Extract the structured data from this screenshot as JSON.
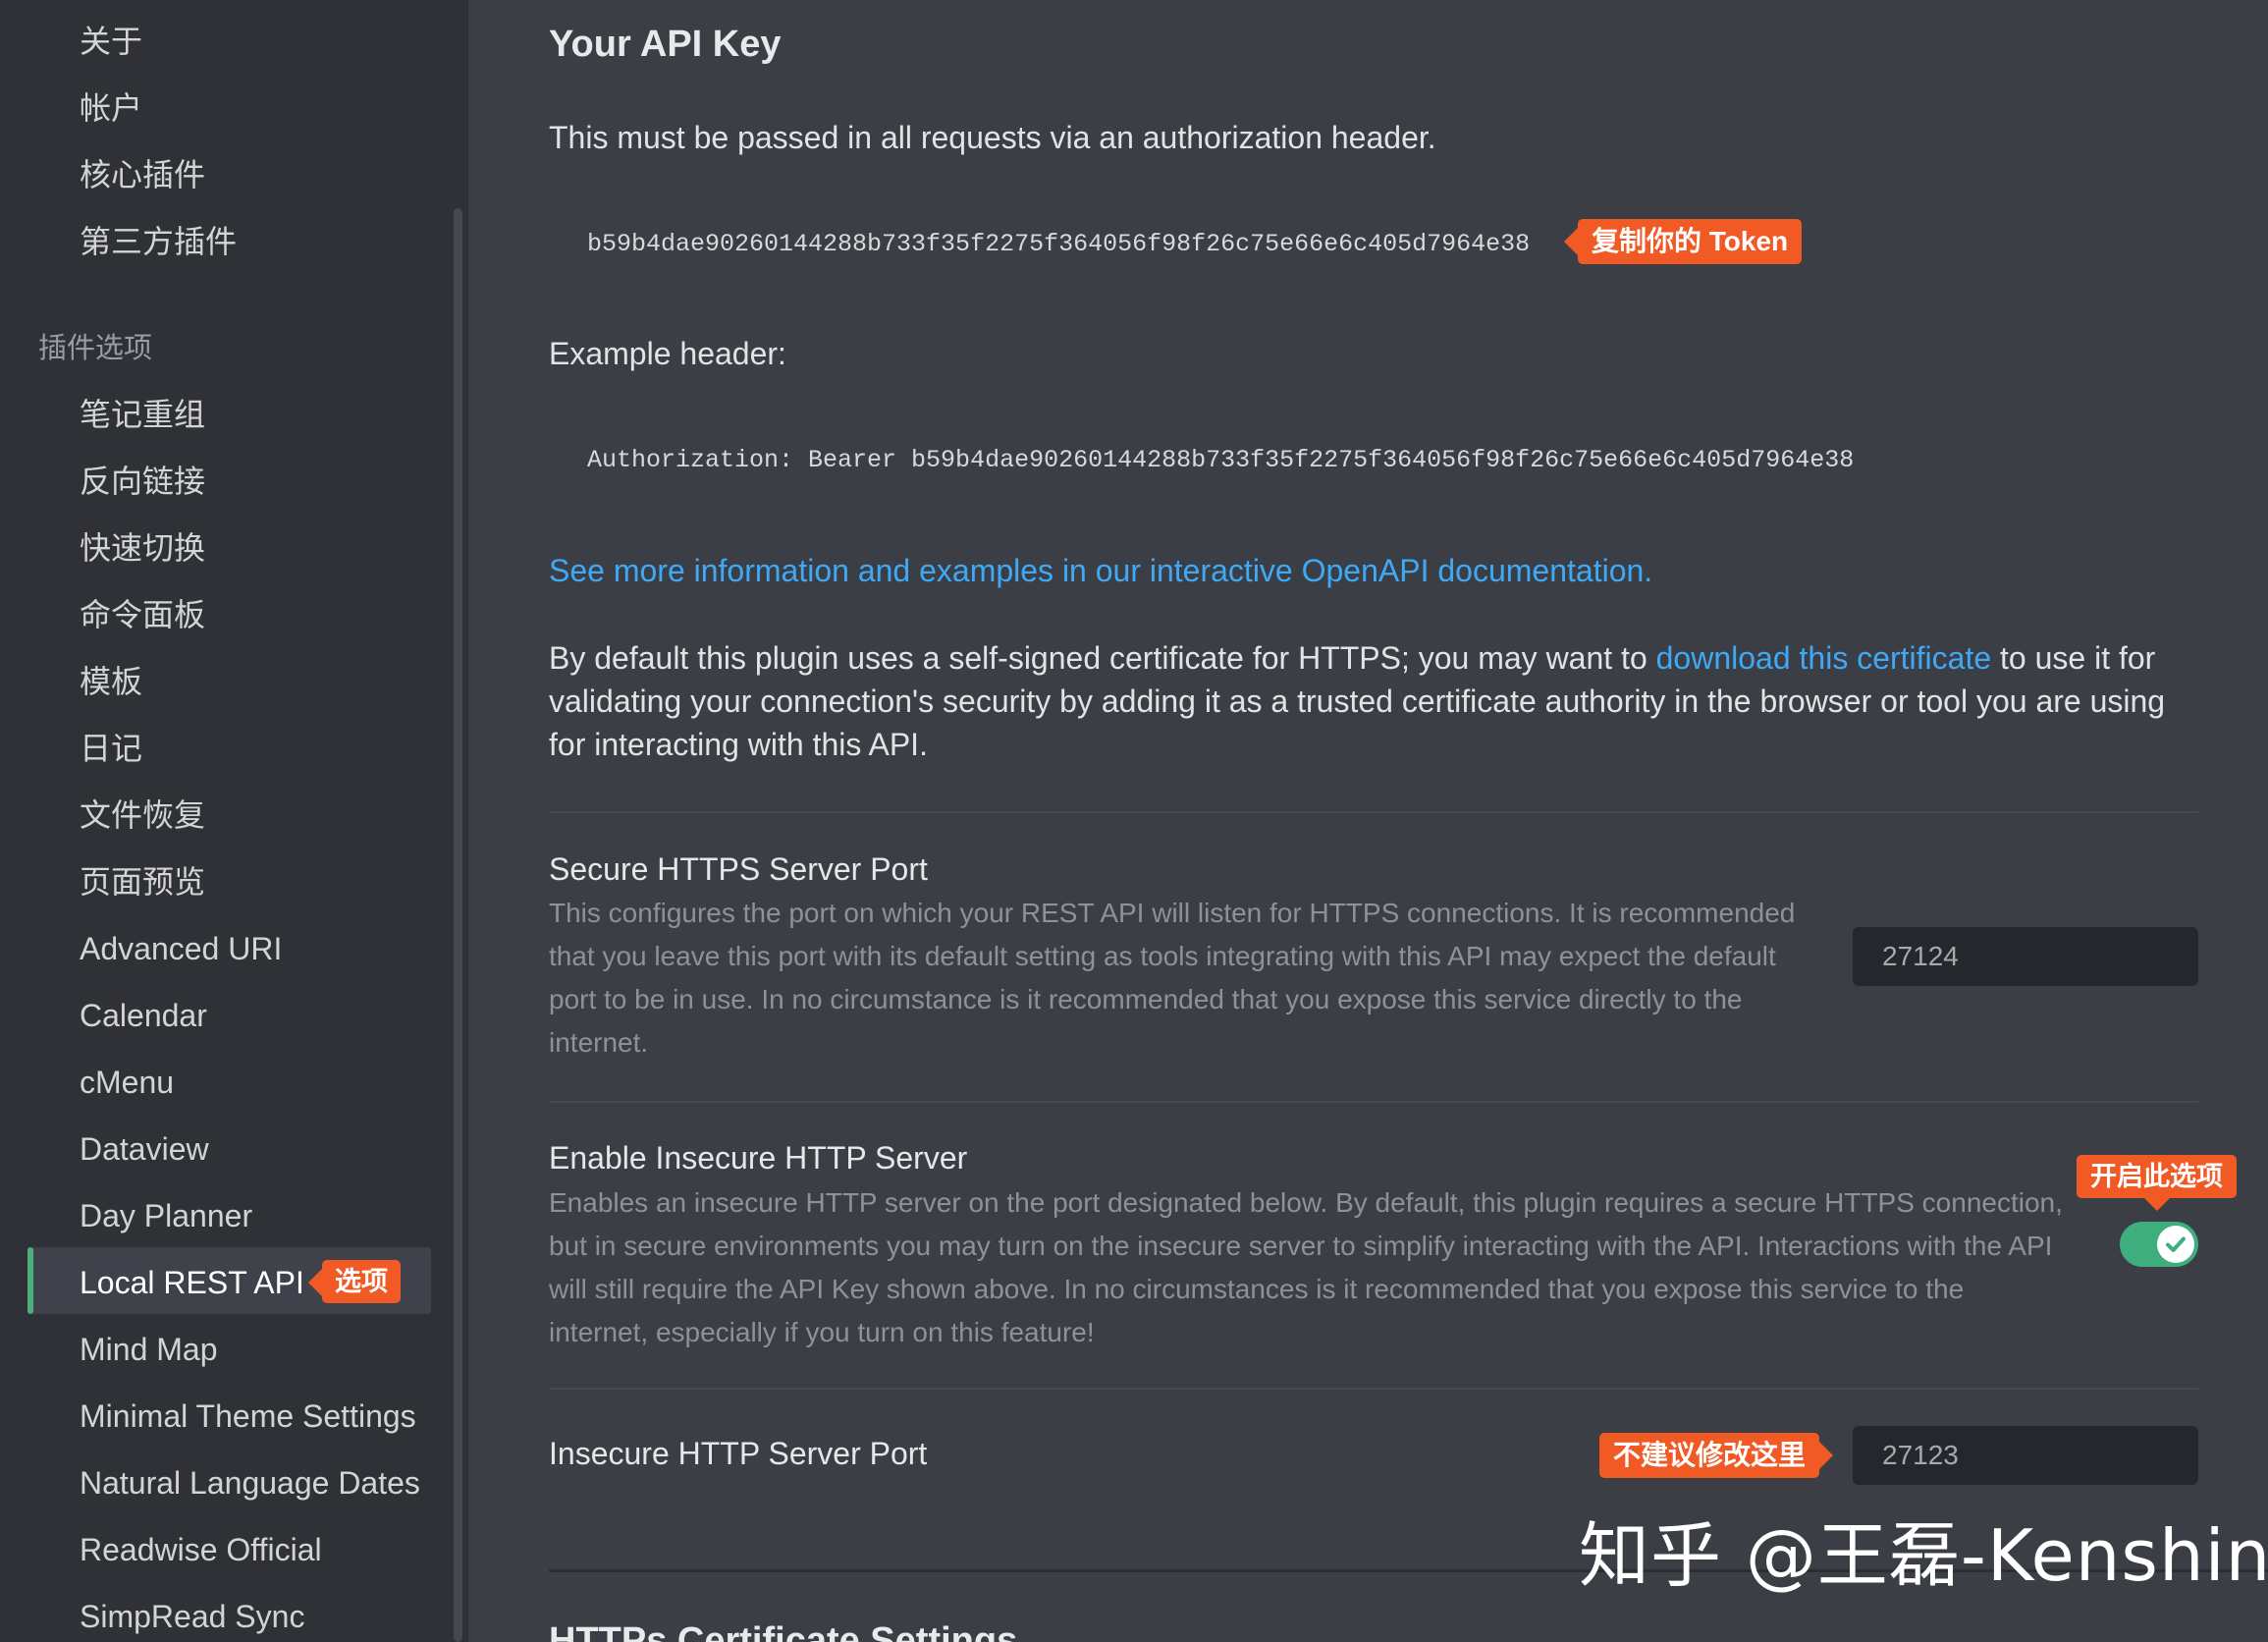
{
  "sidebar": {
    "top_items": [
      "关于",
      "帐户",
      "核心插件",
      "第三方插件"
    ],
    "section_heading": "插件选项",
    "plugin_items": [
      "笔记重组",
      "反向链接",
      "快速切换",
      "命令面板",
      "模板",
      "日记",
      "文件恢复",
      "页面预览",
      "Advanced URI",
      "Calendar",
      "cMenu",
      "Dataview",
      "Day Planner",
      "Local REST API",
      "Mind Map",
      "Minimal Theme Settings",
      "Natural Language Dates",
      "Readwise Official",
      "SimpRead Sync"
    ],
    "active_item": "Local REST API",
    "active_badge": "选项"
  },
  "api_key": {
    "title": "Your API Key",
    "description": "This must be passed in all requests via an authorization header.",
    "token": "b59b4dae90260144288b733f35f2275f364056f98f26c75e66e6c405d7964e38",
    "token_badge": "复制你的 Token",
    "example_label": "Example header:",
    "example_header": "Authorization: Bearer b59b4dae90260144288b733f35f2275f364056f98f26c75e66e6c405d7964e38",
    "docs_link": "See more information and examples in our interactive OpenAPI documentation.",
    "cert_text_before": "By default this plugin uses a self-signed certificate for HTTPS; you may want to ",
    "cert_link": "download this certificate",
    "cert_text_line1_after": " to use it for",
    "cert_text_line2": "validating your connection's security by adding it as a trusted certificate authority in the browser or tool you are using",
    "cert_text_line3": "for interacting with this API."
  },
  "settings": {
    "https_port": {
      "name": "Secure HTTPS Server Port",
      "desc_lines": [
        "This configures the port on which your REST API will listen for HTTPS connections. It is recommended",
        "that you leave this port with its default setting as tools integrating with this API may expect the default",
        "port to be in use. In no circumstance is it recommended that you expose this service directly to the",
        "internet."
      ],
      "value": "27124"
    },
    "insecure_server": {
      "name": "Enable Insecure HTTP Server",
      "desc_lines": [
        "Enables an insecure HTTP server on the port designated below. By default, this plugin requires a secure HTTPS connection,",
        "but in secure environments you may turn on the insecure server to simplify interacting with the API. Interactions with the API",
        "will still require the API Key shown above. In no circumstances is it recommended that you expose this service to the",
        "internet, especially if you turn on this feature!"
      ],
      "badge": "开启此选项",
      "enabled": true
    },
    "http_port": {
      "name": "Insecure HTTP Server Port",
      "value": "27123",
      "badge": "不建议修改这里"
    }
  },
  "next_section_title": "HTTPs Certificate Settings",
  "watermark": "知乎 @王磊-Kenshin",
  "colors": {
    "sidebar_bg": "#2f3137",
    "main_bg": "#3b3e45",
    "accent_green": "#3fae7e",
    "link_blue": "#3fa9f5",
    "badge_orange": "#f15a24"
  }
}
